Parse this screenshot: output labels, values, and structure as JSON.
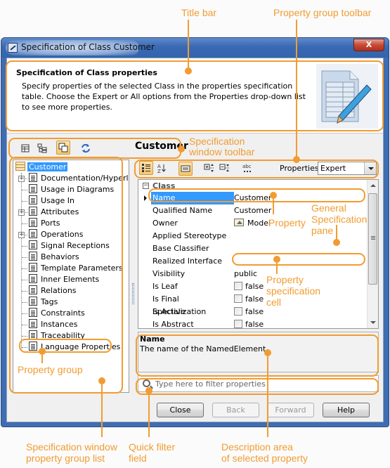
{
  "window": {
    "title": "Specification of Class Customer",
    "close_label": "X"
  },
  "header": {
    "title": "Specification of Class properties",
    "description": "Specify properties of the selected Class in the properties specification table. Choose the Expert or All options from the Properties drop-down list to see more properties."
  },
  "spec_toolbar": {
    "element_name": "Customer",
    "buttons": [
      "table-view-icon",
      "tree-view-icon",
      "standalone-window-icon",
      "refresh-icon"
    ]
  },
  "tree": {
    "root": "Customer",
    "items": [
      {
        "label": "Documentation/Hyperlinks",
        "expandable": true
      },
      {
        "label": "Usage in Diagrams",
        "expandable": false
      },
      {
        "label": "Usage In",
        "expandable": false
      },
      {
        "label": "Attributes",
        "expandable": true
      },
      {
        "label": "Ports",
        "expandable": false
      },
      {
        "label": "Operations",
        "expandable": true
      },
      {
        "label": "Signal Receptions",
        "expandable": false
      },
      {
        "label": "Behaviors",
        "expandable": false
      },
      {
        "label": "Template Parameters",
        "expandable": false
      },
      {
        "label": "Inner Elements",
        "expandable": false
      },
      {
        "label": "Relations",
        "expandable": false
      },
      {
        "label": "Tags",
        "expandable": false
      },
      {
        "label": "Constraints",
        "expandable": false
      },
      {
        "label": "Instances",
        "expandable": false
      },
      {
        "label": "Traceability",
        "expandable": false
      },
      {
        "label": "Language Properties",
        "expandable": false
      }
    ]
  },
  "prop_toolbar": {
    "buttons": [
      "categorized-icon",
      "sort-alphabetically-icon",
      "show-description-icon",
      "expand-all-icon",
      "collapse-all-icon",
      "abc-icon"
    ],
    "properties_label": "Properties:",
    "properties_value": "Expert"
  },
  "grid": {
    "category": "Class",
    "rows": [
      {
        "key": "Name",
        "value": "Customer",
        "type": "text",
        "selected": true
      },
      {
        "key": "Qualified Name",
        "value": "Customer",
        "type": "text"
      },
      {
        "key": "Owner",
        "value": "Model",
        "type": "model"
      },
      {
        "key": "Applied Stereotype",
        "value": "",
        "type": "text"
      },
      {
        "key": "Base Classifier",
        "value": "",
        "type": "text"
      },
      {
        "key": "Realized Interface",
        "value": "",
        "type": "text"
      },
      {
        "key": "Visibility",
        "value": "public",
        "type": "text"
      },
      {
        "key": "Is Leaf",
        "value": "false",
        "type": "checkbox"
      },
      {
        "key": "Is Final Specialization",
        "value": "false",
        "type": "checkbox"
      },
      {
        "key": "Is Active",
        "value": "false",
        "type": "checkbox"
      },
      {
        "key": "Is Abstract",
        "value": "false",
        "type": "checkbox"
      }
    ]
  },
  "description": {
    "title": "Name",
    "text": "The name of the NamedElement."
  },
  "filter": {
    "placeholder": "Type here to filter properties",
    "value": ""
  },
  "buttons": {
    "close": "Close",
    "back": "Back",
    "forward": "Forward",
    "help": "Help"
  },
  "callouts": {
    "title_bar": "Title bar",
    "property_group_toolbar": "Property group toolbar",
    "spec_window_toolbar_1": "Specification",
    "spec_window_toolbar_2": "window  toolbar",
    "property": "Property",
    "general_spec_1": "General",
    "general_spec_2": "Specification",
    "general_spec_3": "pane",
    "prop_spec_cell_1": "Property",
    "prop_spec_cell_2": "specification",
    "prop_spec_cell_3": "cell",
    "property_group": "Property group",
    "spec_group_list_1": "Specification window",
    "spec_group_list_2": "property group list",
    "quick_filter_1": "Quick filter",
    "quick_filter_2": "field",
    "desc_area_1": "Description area",
    "desc_area_2": "of selected property"
  },
  "accent_color": "#f19c31"
}
